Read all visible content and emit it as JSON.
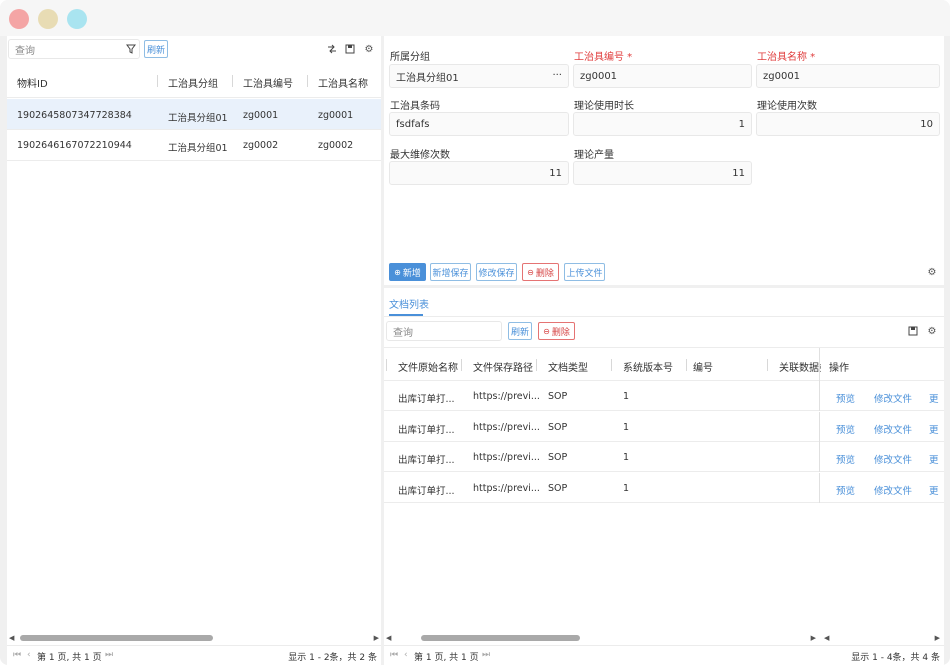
{
  "window": {
    "colors": {
      "close": "#f4a5a5",
      "minimize": "#e8dcb4",
      "maximize": "#a9e4f0",
      "accent": "#4a90d9",
      "danger": "#e03c3c"
    }
  },
  "left": {
    "search_placeholder": "查询",
    "refresh_label": "刷新",
    "columns": [
      "物料ID",
      "工治具分组",
      "工治具编号",
      "工治具名称"
    ],
    "rows": [
      [
        "1902645807347728384",
        "工治具分组01",
        "zg0001",
        "zg0001"
      ],
      [
        "1902646167072210944",
        "工治具分组01",
        "zg0002",
        "zg0002"
      ]
    ],
    "footer": {
      "pager": "第 1 页, 共 1 页",
      "summary": "显示 1 - 2条，共 2 条"
    }
  },
  "form": {
    "group_label": "所属分组",
    "group_value": "工治具分组01",
    "group_more": "···",
    "code_label": "工治具编号 *",
    "code_value": "zg0001",
    "name_label": "工治具名称 *",
    "name_value": "zg0001",
    "barcode_label": "工治具条码",
    "barcode_value": "fsdfafs",
    "duration_label": "理论使用时长",
    "duration_value": "1",
    "uses_label": "理论使用次数",
    "uses_value": "10",
    "repair_label": "最大维修次数",
    "repair_value": "11",
    "output_label": "理论产量",
    "output_value": "11"
  },
  "toolbar": {
    "add": "新增",
    "add_save": "新增保存",
    "edit_save": "修改保存",
    "delete": "删除",
    "upload": "上传文件"
  },
  "docs": {
    "tab": "文档列表",
    "search_placeholder": "查询",
    "refresh": "刷新",
    "delete": "删除",
    "columns": [
      "文件原始名称",
      "文件保存路径",
      "文档类型",
      "系统版本号",
      "编号",
      "关联数据券",
      "操作"
    ],
    "rows": [
      [
        "出库订单打...",
        "https://previ...",
        "SOP",
        "1"
      ],
      [
        "出库订单打...",
        "https://previ...",
        "SOP",
        "1"
      ],
      [
        "出库订单打...",
        "https://previ...",
        "SOP",
        "1"
      ],
      [
        "出库订单打...",
        "https://previ...",
        "SOP",
        "1"
      ]
    ],
    "actions": {
      "preview": "预览",
      "edit_file": "修改文件",
      "more": "更"
    },
    "footer": {
      "pager": "第 1 页, 共 1 页",
      "summary": "显示 1 - 4条，共 4 条"
    }
  }
}
